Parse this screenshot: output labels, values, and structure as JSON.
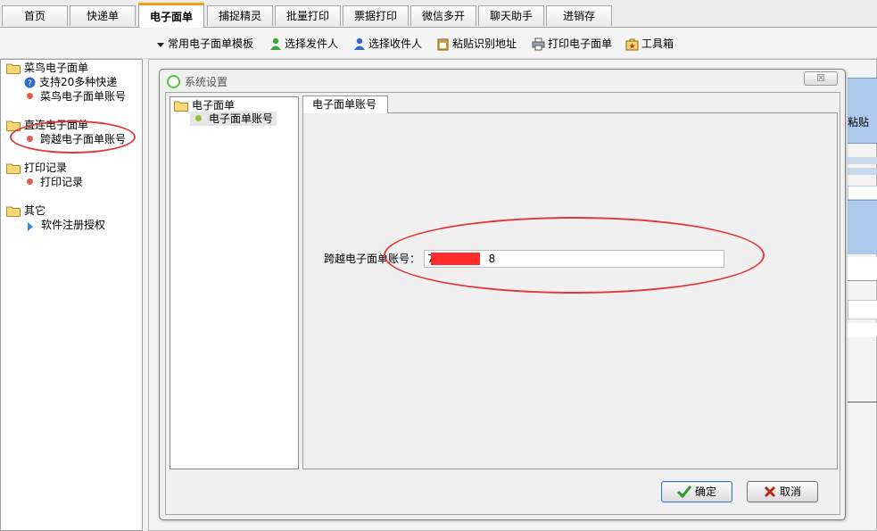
{
  "tabs": [
    {
      "label": "首页"
    },
    {
      "label": "快递单"
    },
    {
      "label": "电子面单",
      "active": true
    },
    {
      "label": "捕捉精灵"
    },
    {
      "label": "批量打印"
    },
    {
      "label": "票据打印"
    },
    {
      "label": "微信多开"
    },
    {
      "label": "聊天助手"
    },
    {
      "label": "进销存"
    }
  ],
  "toolbar": {
    "template": "常用电子面单模板",
    "select_sender": "选择发件人",
    "select_receiver": "选择收件人",
    "paste_address": "粘贴识别地址",
    "print_waybill": "打印电子面单",
    "toolbox": "工具箱"
  },
  "left_tree": {
    "cainiao": {
      "label": "菜鸟电子面单",
      "items": [
        "支持20多种快递",
        "菜鸟电子面单账号"
      ]
    },
    "direct": {
      "label": "直连电子面单",
      "items": [
        "跨越电子面单账号"
      ]
    },
    "print_log": {
      "label": "打印记录",
      "items": [
        "打印记录"
      ]
    },
    "other": {
      "label": "其它",
      "items": [
        "软件注册授权"
      ]
    }
  },
  "background": {
    "paste_label": "粘贴"
  },
  "dialog": {
    "title": "系统设置",
    "close_label": "☒",
    "tree_root": "电子面单",
    "tree_child": "电子面单账号",
    "tab_label": "电子面单账号",
    "field_label": "跨越电子面单账号：",
    "field_value": "7                8",
    "ok_label": "确定",
    "cancel_label": "取消"
  },
  "colors": {
    "active_tab_accent": "#f6a31b",
    "annotation_red": "#e03a3a",
    "redaction": "#ff2a2a"
  }
}
